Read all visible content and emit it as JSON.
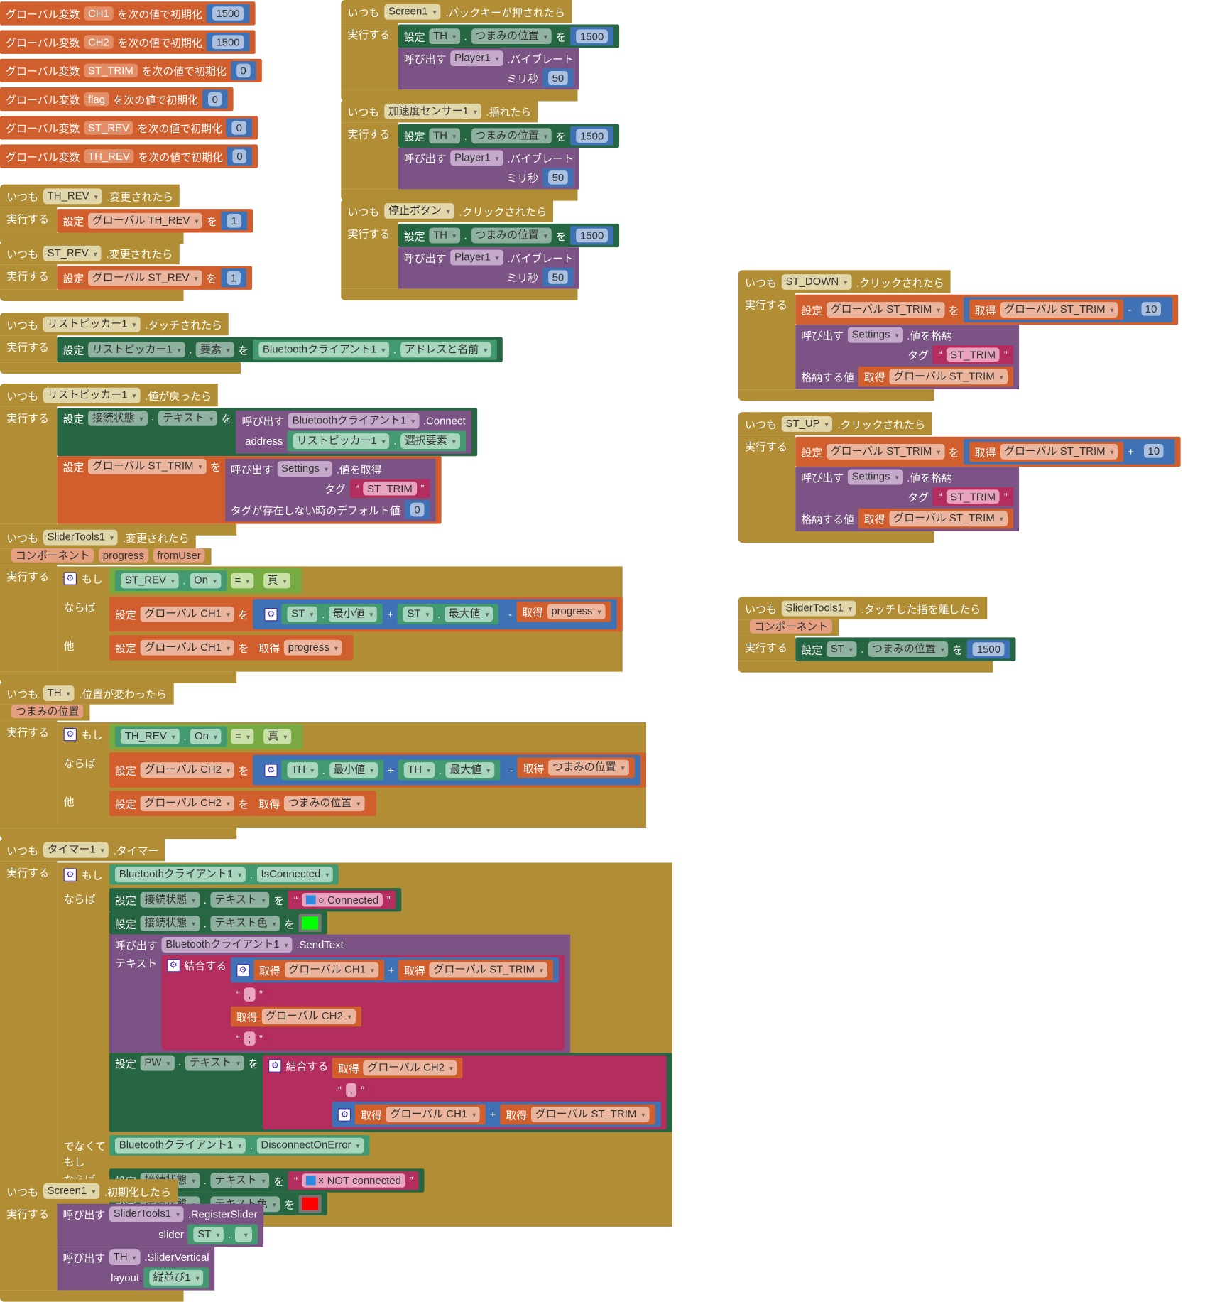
{
  "kw": {
    "always": "いつも",
    "do": "実行する",
    "set": "設定",
    "to": "を",
    "call": "呼び出す",
    "get": "取得",
    "if": "もし",
    "then": "ならば",
    "else": "他",
    "elseif": "でなくてもし",
    "join": "結合する",
    "global_var": "グローバル変数",
    "init": "を次の値で初期化",
    "dot": ".",
    "plus": "+",
    "minus": "-",
    "eq": "=",
    "true": "真",
    "q_open": "“",
    "q_close": "”"
  },
  "globals": [
    {
      "name": "CH1",
      "value": "1500"
    },
    {
      "name": "CH2",
      "value": "1500"
    },
    {
      "name": "ST_TRIM",
      "value": "0"
    },
    {
      "name": "flag",
      "value": "0"
    },
    {
      "name": "ST_REV",
      "value": "0"
    },
    {
      "name": "TH_REV",
      "value": "0"
    }
  ],
  "th_rev_changed": {
    "component": "TH_REV",
    "event": ".変更されたら",
    "var": "グローバル TH_REV",
    "value": "1"
  },
  "st_rev_changed": {
    "component": "ST_REV",
    "event": ".変更されたら",
    "var": "グローバル ST_REV",
    "value": "1"
  },
  "picker_before": {
    "component": "リストピッカー1",
    "event": ".タッチされたら",
    "target": "リストピッカー1",
    "prop": "要素",
    "src": "Bluetoothクライアント1",
    "src_prop": "アドレスと名前"
  },
  "picker_after": {
    "component": "リストピッカー1",
    "event": ".値が戻ったら",
    "label": "接続状態",
    "prop": "テキスト",
    "bt": "Bluetoothクライアント1",
    "method": ".Connect",
    "arg": "address",
    "picker": "リストピッカー1",
    "picker_prop": "選択要素",
    "var": "グローバル ST_TRIM",
    "settings": "Settings",
    "get_method": ".値を取得",
    "tag_label": "タグ",
    "tag": "ST_TRIM",
    "default_label": "タグが存在しない時のデフォルト値",
    "default": "0"
  },
  "slider_changed": {
    "component": "SliderTools1",
    "event": ".変更されたら",
    "params": [
      "コンポーネント",
      "progress",
      "fromUser"
    ],
    "cond_comp": "ST_REV",
    "cond_prop": "On",
    "var": "グローバル CH1",
    "min_comp": "ST",
    "min_prop": "最小値",
    "max_comp": "ST",
    "max_prop": "最大値",
    "get_param": "progress"
  },
  "th_moved": {
    "component": "TH",
    "event": ".位置が変わったら",
    "params": [
      "つまみの位置"
    ],
    "cond_comp": "TH_REV",
    "cond_prop": "On",
    "var": "グローバル CH2",
    "min_comp": "TH",
    "min_prop": "最小値",
    "max_comp": "TH",
    "max_prop": "最大値",
    "get_param": "つまみの位置"
  },
  "timer": {
    "component": "タイマー1",
    "event": ".タイマー",
    "bt": "Bluetoothクライアント1",
    "is_connected": "IsConnected",
    "label": "接続状態",
    "text_prop": "テキスト",
    "color_prop": "テキスト色",
    "connected": "○ Connected",
    "send_method": ".SendText",
    "text_arg": "テキスト",
    "var_ch1": "グローバル CH1",
    "var_trim": "グローバル ST_TRIM",
    "var_ch2": "グローバル CH2",
    "comma": ",",
    "semicolon": ";",
    "pw": "PW",
    "disconnect": "DisconnectOnError",
    "not_connected": "× NOT connected",
    "green": "#00ff00",
    "red": "#ff0000"
  },
  "screen_init": {
    "component": "Screen1",
    "event": ".初期化したら",
    "slidertools": "SliderTools1",
    "register": ".RegisterSlider",
    "slider_arg": "slider",
    "slider": "ST",
    "th": "TH",
    "vertical": ".SliderVertical",
    "layout_arg": "layout",
    "layout": "縦並び1"
  },
  "back_pressed": {
    "component": "Screen1",
    "event": ".バックキーが押されたら",
    "target": "TH",
    "prop": "つまみの位置",
    "value": "1500",
    "player": "Player1",
    "vibrate": ".バイブレート",
    "ms_label": "ミリ秒",
    "ms": "50"
  },
  "shaken": {
    "component": "加速度センサー1",
    "event": ".揺れたら",
    "target": "TH",
    "prop": "つまみの位置",
    "value": "1500",
    "player": "Player1",
    "vibrate": ".バイブレート",
    "ms_label": "ミリ秒",
    "ms": "50"
  },
  "stop_click": {
    "component": "停止ボタン",
    "event": ".クリックされたら",
    "target": "TH",
    "prop": "つまみの位置",
    "value": "1500",
    "player": "Player1",
    "vibrate": ".バイブレート",
    "ms_label": "ミリ秒",
    "ms": "50"
  },
  "st_down": {
    "component": "ST_DOWN",
    "event": ".クリックされたら",
    "var": "グローバル ST_TRIM",
    "op": "-",
    "step": "10",
    "settings": "Settings",
    "store": ".値を格納",
    "tag_label": "タグ",
    "tag": "ST_TRIM",
    "value_label": "格納する値"
  },
  "st_up": {
    "component": "ST_UP",
    "event": ".クリックされたら",
    "var": "グローバル ST_TRIM",
    "op": "+",
    "step": "10",
    "settings": "Settings",
    "store": ".値を格納",
    "tag_label": "タグ",
    "tag": "ST_TRIM",
    "value_label": "格納する値"
  },
  "slider_release": {
    "component": "SliderTools1",
    "event": ".タッチした指を離したら",
    "param": "コンポーネント",
    "target": "ST",
    "prop": "つまみの位置",
    "value": "1500"
  }
}
